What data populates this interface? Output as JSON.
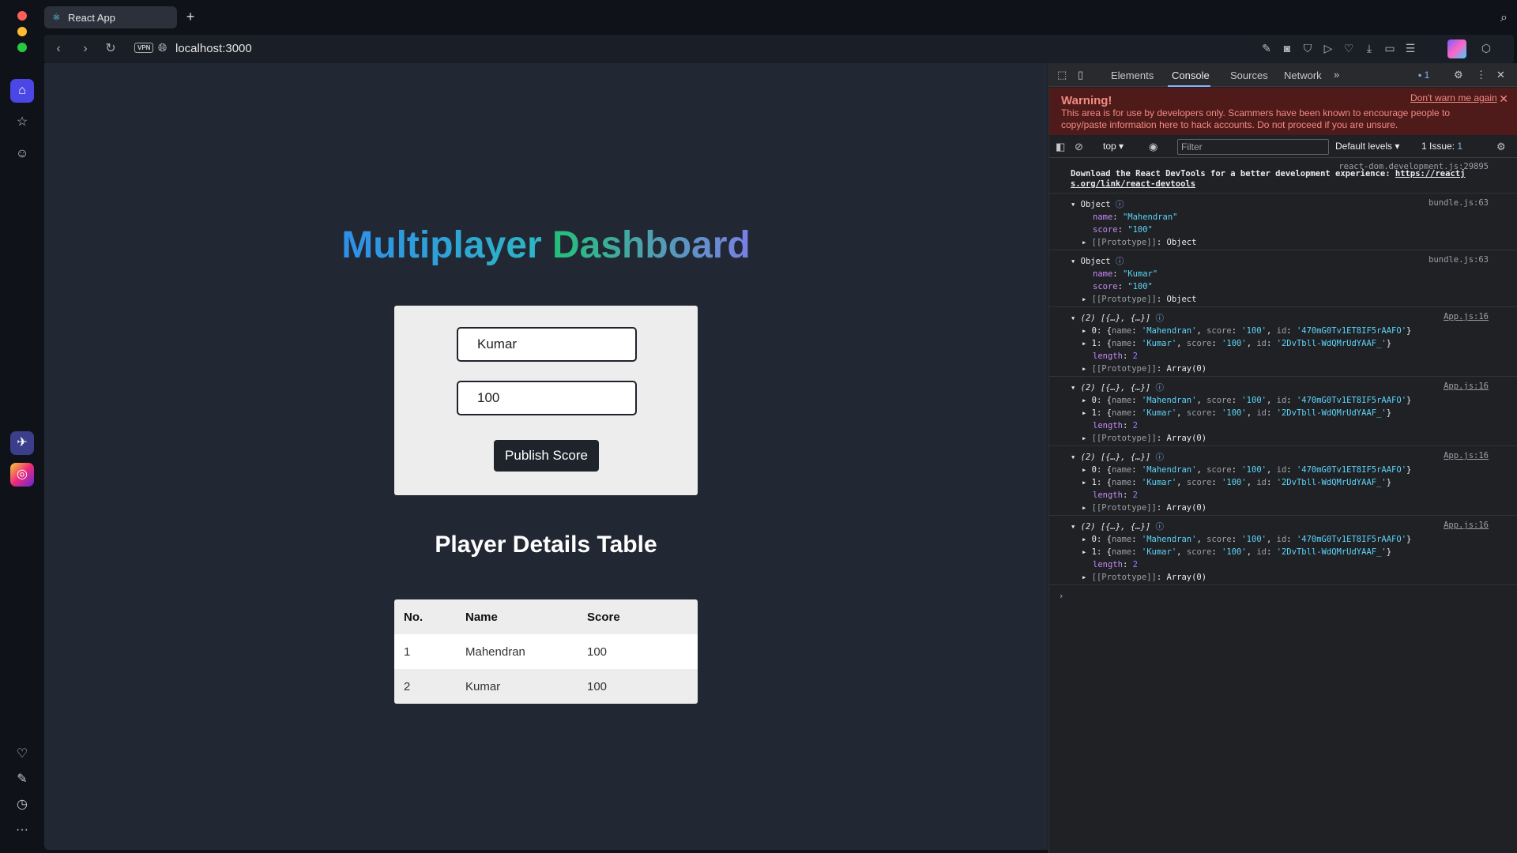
{
  "browser": {
    "tab_title": "React App",
    "url": "localhost:3000",
    "vpn_label": "VPN"
  },
  "page": {
    "title_word1": "Multiplayer",
    "title_word2": "Dashboard",
    "form": {
      "name_value": "Kumar",
      "score_value": "100",
      "publish_label": "Publish Score"
    },
    "table_title": "Player Details Table",
    "table": {
      "headers": [
        "No.",
        "Name",
        "Score"
      ],
      "rows": [
        [
          "1",
          "Mahendran",
          "100"
        ],
        [
          "2",
          "Kumar",
          "100"
        ]
      ]
    }
  },
  "devtools": {
    "tabs": [
      "Elements",
      "Console",
      "Sources",
      "Network"
    ],
    "issue_count": "1",
    "warning": {
      "title": "Warning!",
      "dont_warn": "Don't warn me again",
      "text": "This area is for use by developers only. Scammers have been known to encourage people to copy/paste information here to hack accounts. Do not proceed if you are unsure."
    },
    "toolbar": {
      "context": "top",
      "filter_placeholder": "Filter",
      "levels": "Default levels",
      "issues": "1 Issue:",
      "issues_count": "1"
    },
    "console": {
      "devtools_src": "react-dom.development.js:29895",
      "devtools_msg": "Download the React DevTools for a better development experience: ",
      "devtools_link1": "https://reactj",
      "devtools_link2": "s.org/link/react-devtools",
      "obj_src": "bundle.js:63",
      "arr_src": "App.js:16",
      "objects": [
        {
          "name": "\"Mahendran\"",
          "score": "\"100\""
        },
        {
          "name": "\"Kumar\"",
          "score": "\"100\""
        }
      ],
      "arr_header": "(2) [{…}, {…}]",
      "arr_line0": "'Mahendran'",
      "arr_line1": "'Kumar'",
      "arr_score": "'100'",
      "arr_id0": "'470mG0Tv1ET8IF5rAAFO'",
      "arr_id1": "'2DvTbll-WdQMrUdYAAF_'",
      "length_label": "length",
      "length_value": "2",
      "proto_object": "Object",
      "proto_array": "Array(0)"
    }
  }
}
